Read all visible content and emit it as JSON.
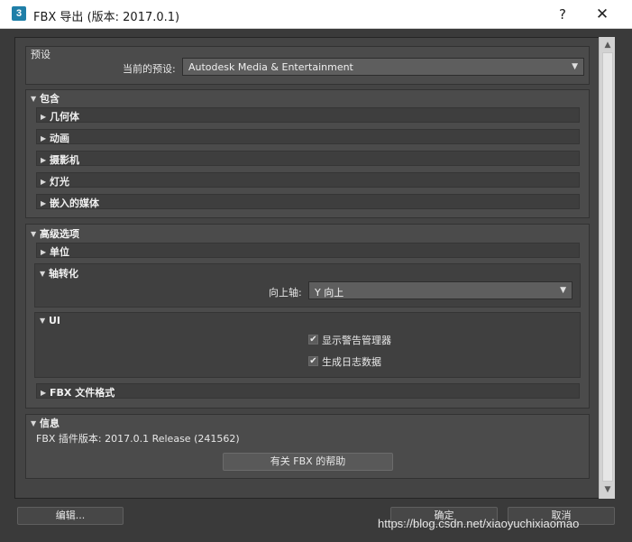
{
  "window": {
    "icon_glyph": "3",
    "title": "FBX 导出 (版本: 2017.0.1)",
    "help": "?",
    "close": "✕"
  },
  "preset": {
    "group_label": "预设",
    "current_label": "当前的预设:",
    "current_value": "Autodesk Media & Entertainment"
  },
  "include": {
    "label": "包含",
    "items": [
      "几何体",
      "动画",
      "摄影机",
      "灯光",
      "嵌入的媒体"
    ]
  },
  "advanced": {
    "label": "高级选项",
    "units": "单位",
    "axis": {
      "label": "轴转化",
      "up_axis_label": "向上轴:",
      "up_axis_value": "Y 向上"
    },
    "ui": {
      "label": "UI",
      "show_warning": "显示警告管理器",
      "generate_log": "生成日志数据",
      "show_warning_checked": true,
      "generate_log_checked": true
    },
    "file_format": "FBX 文件格式"
  },
  "info": {
    "label": "信息",
    "plugin_version": "FBX 插件版本: 2017.0.1 Release (241562)",
    "help_button": "有关 FBX 的帮助"
  },
  "footer": {
    "edit_button": "编辑...",
    "ok_button": "确定",
    "cancel_button": "取消"
  },
  "icons": {
    "expanded": "▼",
    "collapsed": "▶",
    "caret": "▼",
    "check": "✔",
    "scroll_up": "▲",
    "scroll_down": "▼"
  },
  "watermark": "https://blog.csdn.net/xiaoyuchixiaomao"
}
